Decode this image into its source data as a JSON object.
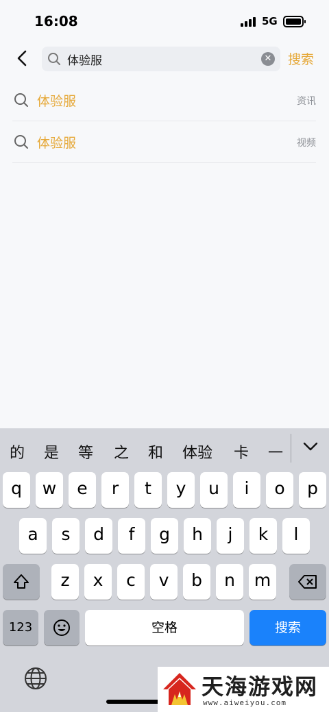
{
  "status_bar": {
    "time": "16:08",
    "network": "5G"
  },
  "search": {
    "value": "体验服",
    "submit_label": "搜索",
    "clear_symbol": "✕"
  },
  "suggestions": [
    {
      "text": "体验服",
      "tag": "资讯"
    },
    {
      "text": "体验服",
      "tag": "视频"
    }
  ],
  "keyboard": {
    "candidates": [
      "的",
      "是",
      "等",
      "之",
      "和",
      "体验",
      "卡",
      "一"
    ],
    "row1": [
      "q",
      "w",
      "e",
      "r",
      "t",
      "y",
      "u",
      "i",
      "o",
      "p"
    ],
    "row2": [
      "a",
      "s",
      "d",
      "f",
      "g",
      "h",
      "j",
      "k",
      "l"
    ],
    "row3": [
      "z",
      "x",
      "c",
      "v",
      "b",
      "n",
      "m"
    ],
    "numbers_label": "123",
    "space_label": "空格",
    "search_label": "搜索"
  },
  "watermark": {
    "name": "天海游戏网",
    "url": "www.aiweiyou.com"
  },
  "colors": {
    "accent": "#e6a93a",
    "keyboard_bg": "#d3d5db",
    "action_blue": "#1a82fb"
  }
}
